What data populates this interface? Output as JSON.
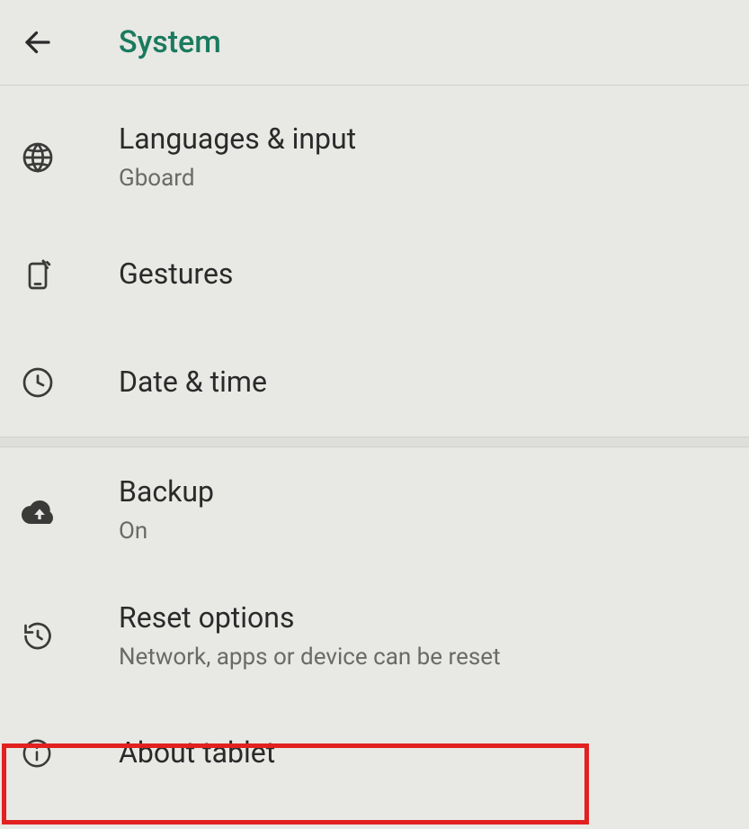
{
  "header": {
    "title": "System"
  },
  "items": [
    {
      "title": "Languages & input",
      "subtitle": "Gboard"
    },
    {
      "title": "Gestures",
      "subtitle": ""
    },
    {
      "title": "Date & time",
      "subtitle": ""
    },
    {
      "title": "Backup",
      "subtitle": "On"
    },
    {
      "title": "Reset options",
      "subtitle": "Network, apps or device can be reset"
    },
    {
      "title": "About tablet",
      "subtitle": ""
    }
  ]
}
